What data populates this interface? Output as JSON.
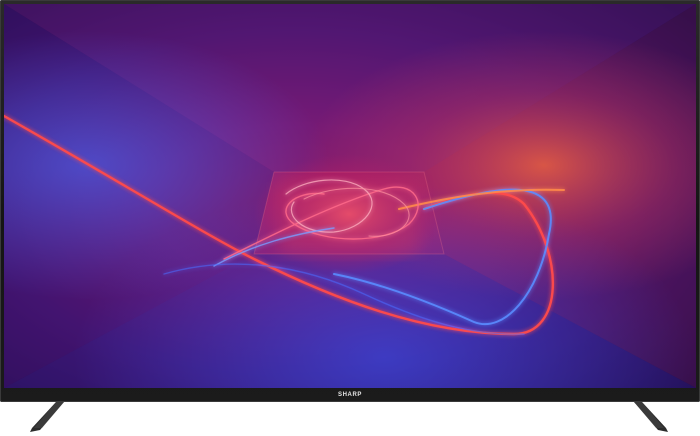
{
  "product": {
    "brand_logo": "SHARP"
  },
  "colors": {
    "bezel": "#1b1b1b",
    "stand": "#2a2a2a",
    "screen_base": "#2a0a3a",
    "accent_red": "#ff3a3a",
    "accent_blue": "#4a8cff",
    "accent_orange": "#ff7a2a"
  }
}
